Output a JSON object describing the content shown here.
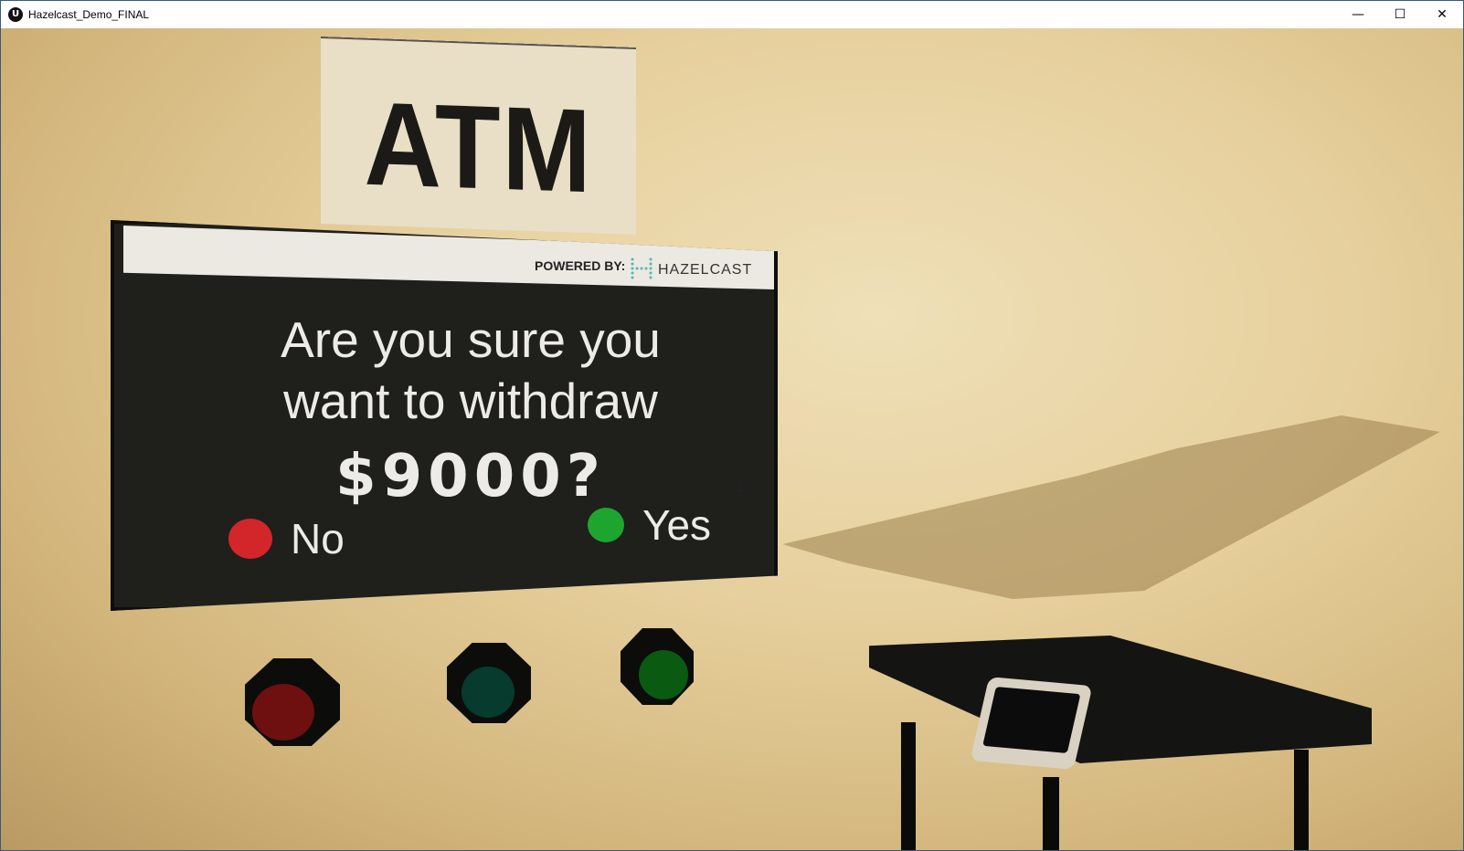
{
  "window": {
    "title": "Hazelcast_Demo_FINAL",
    "controls": {
      "minimize": "—",
      "maximize": "☐",
      "close": "✕"
    }
  },
  "scene": {
    "sign": {
      "text": "ATM"
    },
    "screen": {
      "powered_by": "POWERED BY:",
      "brand": "HAZELCAST",
      "question_line1": "Are you sure you",
      "question_line2": "want to withdraw",
      "amount": "$9000?",
      "option_no": "No",
      "option_yes": "Yes"
    },
    "colors": {
      "no_red": "#d3262b",
      "yes_green": "#1ea52f",
      "wall": "#e6cf9c",
      "screen_bg": "#1f1f1c"
    }
  }
}
